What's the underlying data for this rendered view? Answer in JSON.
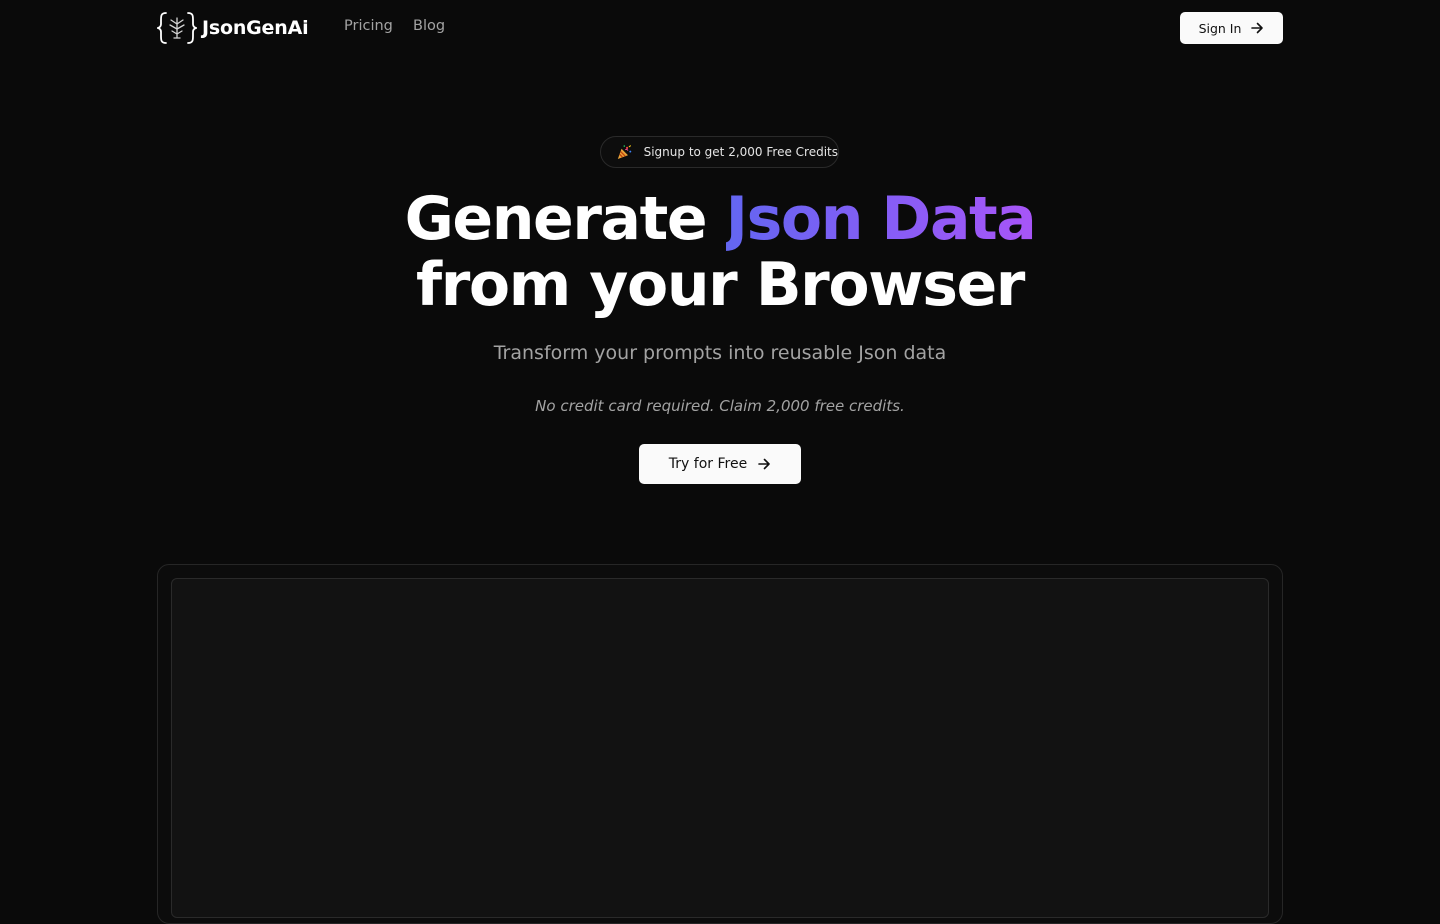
{
  "nav": {
    "brand": "JsonGenAi",
    "brand_icon": "json-braces-logo-icon",
    "links": [
      {
        "label": "Pricing"
      },
      {
        "label": "Blog"
      }
    ],
    "signin_label": "Sign In",
    "signin_icon": "arrow-right-icon"
  },
  "hero": {
    "badge_icon": "party-popper-icon",
    "badge_text": "Signup to get 2,000 Free Credits",
    "headline_part1": "Generate ",
    "headline_highlight": "Json Data",
    "headline_line2": "from your Browser",
    "subtitle": "Transform your prompts into reusable Json data",
    "note": "No credit card required. Claim 2,000 free credits.",
    "cta_label": "Try for Free",
    "cta_icon": "arrow-right-icon"
  },
  "colors": {
    "background": "#0a0a0a",
    "button_bg": "#fafafa",
    "muted_text": "#a3a3a3",
    "gradient_start": "#6366f1",
    "gradient_end": "#a855f7"
  }
}
